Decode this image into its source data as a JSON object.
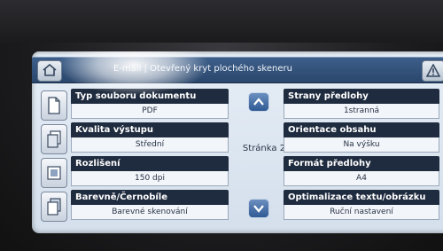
{
  "header": {
    "title": "E-mail | Otevřený kryt plochého skeneru"
  },
  "pagination": {
    "page_label": "Stránka 2"
  },
  "left_options": [
    {
      "label": "Typ souboru dokumentu",
      "value": "PDF",
      "icon": "document-icon"
    },
    {
      "label": "Kvalita výstupu",
      "value": "Střední",
      "icon": "pages-icon"
    },
    {
      "label": "Rozlišení",
      "value": "150 dpi",
      "icon": "resolution-icon"
    },
    {
      "label": "Barevně/Černobíle",
      "value": "Barevné skenování",
      "icon": "color-icon"
    }
  ],
  "right_options": [
    {
      "label": "Strany předlohy",
      "value": "1stranná"
    },
    {
      "label": "Orientace obsahu",
      "value": "Na výšku"
    },
    {
      "label": "Formát předlohy",
      "value": "A4"
    },
    {
      "label": "Optimalizace textu/obrázku",
      "value": "Ruční nastavení"
    }
  ],
  "colors": {
    "header_bg": "#2a466c",
    "label_bg": "#1f2b3e",
    "screen_bg": "#dfe8f2"
  }
}
